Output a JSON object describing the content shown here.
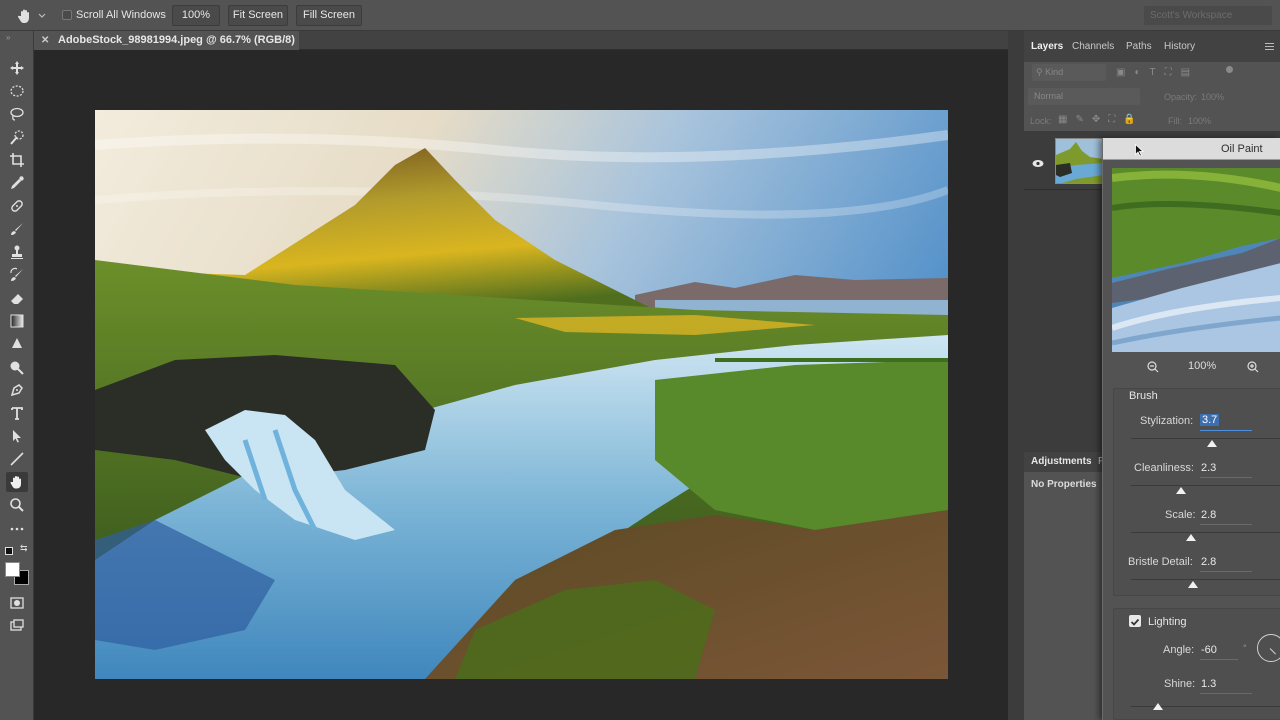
{
  "options_bar": {
    "scroll_all_windows": "Scroll All Windows",
    "zoom_value": "100%",
    "fit_screen": "Fit Screen",
    "fill_screen": "Fill Screen",
    "workspace": "Scott's Workspace"
  },
  "document": {
    "tab_title": "AdobeStock_98981994.jpeg @ 66.7% (RGB/8) *"
  },
  "panels": {
    "tabs": [
      "Layers",
      "Channels",
      "Paths",
      "History"
    ],
    "kind_placeholder": "Kind",
    "blend_mode": "Normal",
    "opacity_label": "Opacity:",
    "opacity_value": "100%",
    "lock_label": "Lock:",
    "fill_label": "Fill:",
    "fill_value": "100%",
    "adjustments_tab": "Adjustments",
    "properties_tab": "P",
    "no_properties": "No Properties"
  },
  "oil_paint": {
    "title": "Oil Paint",
    "zoom": "100%",
    "brush_heading": "Brush",
    "stylization_label": "Stylization:",
    "stylization_value": "3.7",
    "cleanliness_label": "Cleanliness:",
    "cleanliness_value": "2.3",
    "scale_label": "Scale:",
    "scale_value": "2.8",
    "bristle_label": "Bristle Detail:",
    "bristle_value": "2.8",
    "lighting_label": "Lighting",
    "lighting_checked": true,
    "angle_label": "Angle:",
    "angle_value": "-60",
    "angle_unit": "°",
    "shine_label": "Shine:",
    "shine_value": "1.3"
  },
  "colors": {
    "panel_bg": "#535353",
    "toolbar_bg": "#535353",
    "canvas_bg": "#282828",
    "selection": "#3d6fb0"
  },
  "icons": [
    "hand-icon",
    "move-icon",
    "marquee-icon",
    "lasso-icon",
    "quick-select-icon",
    "crop-icon",
    "eyedropper-icon",
    "healing-icon",
    "brush-icon",
    "stamp-icon",
    "history-brush-icon",
    "eraser-icon",
    "gradient-icon",
    "blur-icon",
    "dodge-icon",
    "pen-icon",
    "type-icon",
    "path-select-icon",
    "line-icon",
    "zoom-icon",
    "more-icon",
    "eye-icon",
    "zoom-out-icon",
    "zoom-in-icon",
    "checkbox-icon",
    "angle-dial-icon",
    "panel-menu-icon",
    "cursor-icon"
  ]
}
